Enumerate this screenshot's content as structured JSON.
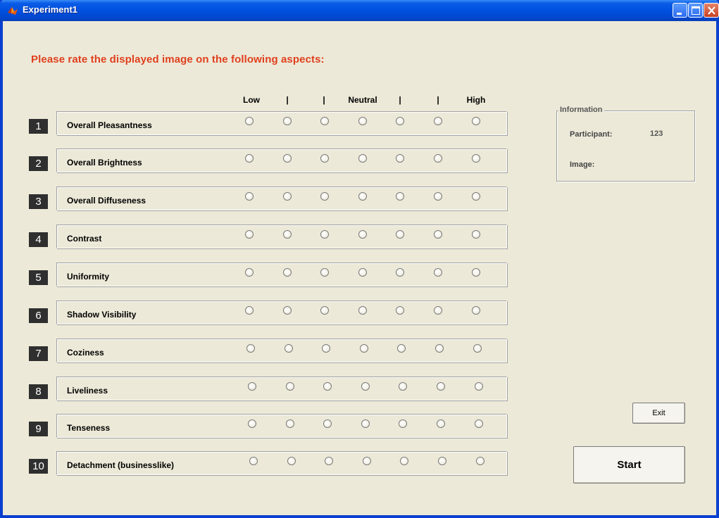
{
  "window": {
    "title": "Experiment1",
    "accent_color": "#0050e0"
  },
  "instruction": "Please rate the displayed image on the following aspects:",
  "instruction_color": "#e0401e",
  "scale_labels": [
    "Low",
    "|",
    "|",
    "Neutral",
    "|",
    "|",
    "High"
  ],
  "items": [
    {
      "number": "1",
      "label": "Overall Pleasantness"
    },
    {
      "number": "2",
      "label": "Overall Brightness"
    },
    {
      "number": "3",
      "label": "Overall Diffuseness"
    },
    {
      "number": "4",
      "label": "Contrast"
    },
    {
      "number": "5",
      "label": "Uniformity"
    },
    {
      "number": "6",
      "label": "Shadow Visibility"
    },
    {
      "number": "7",
      "label": "Coziness"
    },
    {
      "number": "8",
      "label": "Liveliness"
    },
    {
      "number": "9",
      "label": "Tenseness"
    },
    {
      "number": "10",
      "label": "Detachment (businesslike)"
    }
  ],
  "options_per_item": 7,
  "information": {
    "title": "Information",
    "participant_label": "Participant:",
    "participant_value": "123",
    "image_label": "Image:",
    "image_value": ""
  },
  "buttons": {
    "exit": "Exit",
    "start": "Start"
  },
  "icons": {
    "app": "matlab-icon",
    "minimize": "minimize-icon",
    "maximize": "maximize-icon",
    "close": "close-icon"
  }
}
